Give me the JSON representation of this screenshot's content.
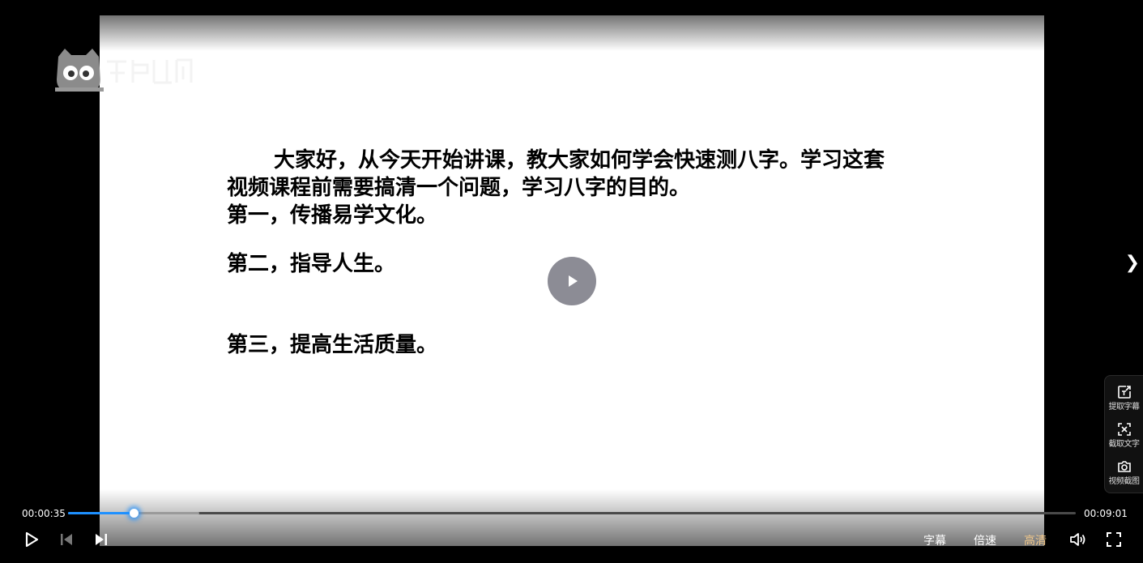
{
  "lesson": {
    "lines": [
      "大家好，从今天开始讲课，教大家如何学会快速测八字。学习这套",
      "视频课程前需要搞清一个问题，学习八字的目的。",
      "第一，传播易学文化。",
      "第二，指导人生。",
      "第三，提高生活质量。"
    ]
  },
  "player": {
    "current_time": "00:00:35",
    "duration": "00:09:01",
    "progress_percent": 6.5,
    "buffered_percent": 13,
    "controls": {
      "subtitle_label": "字幕",
      "speed_label": "倍速",
      "quality_label": "高清"
    },
    "next_glyph": "❯"
  },
  "tools": [
    {
      "label": "提取字幕",
      "icon": "extract-subtitle-icon"
    },
    {
      "label": "截取文字",
      "icon": "capture-text-icon"
    },
    {
      "label": "视频截图",
      "icon": "camera-icon"
    }
  ],
  "colors": {
    "progress": "#1e90ff",
    "quality_active": "#f3c98b"
  }
}
